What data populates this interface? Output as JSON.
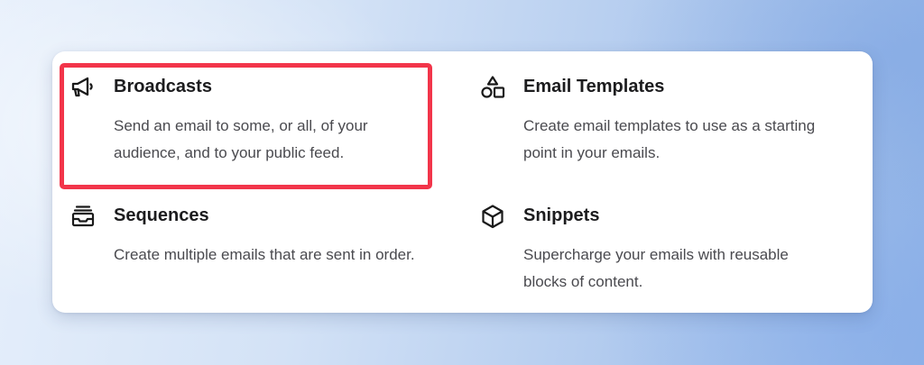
{
  "colors": {
    "highlight": "#f2354a",
    "card_background": "#ffffff",
    "title_text": "#1c1c1e",
    "description_text": "#4a4a4f"
  },
  "features": [
    {
      "icon": "megaphone-icon",
      "title": "Broadcasts",
      "description": "Send an email to some, or all, of your audience, and to your public feed.",
      "highlighted": true
    },
    {
      "icon": "shapes-icon",
      "title": "Email Templates",
      "description": "Create email templates to use as a starting point in your emails."
    },
    {
      "icon": "stacked-inbox-icon",
      "title": "Sequences",
      "description": "Create multiple emails that are sent in order."
    },
    {
      "icon": "cube-icon",
      "title": "Snippets",
      "description": "Supercharge your emails with reusable blocks of content."
    }
  ]
}
